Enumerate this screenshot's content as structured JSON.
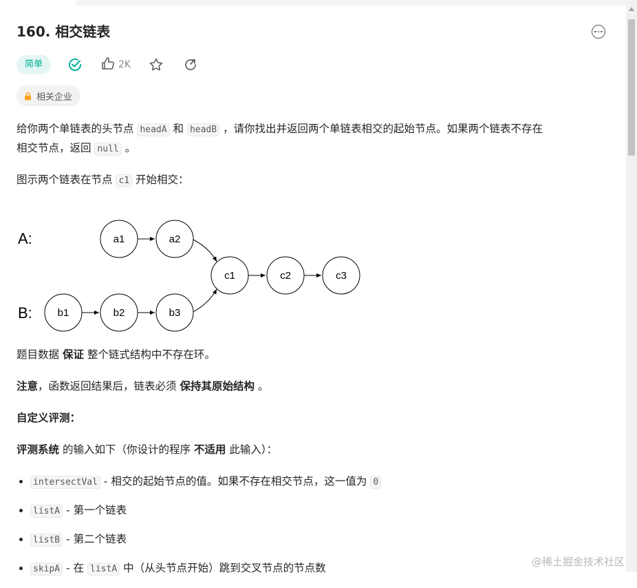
{
  "problem": {
    "title": "160. 相交链表",
    "difficulty": "简单",
    "likes": "2K",
    "company_tag": "相关企业"
  },
  "description": {
    "p1": {
      "t1": "给你两个单链表的头节点 ",
      "c1": "headA",
      "t2": " 和 ",
      "c2": "headB",
      "t3": " ，请你找出并返回两个单链表相交的起始节点。如果两个链表不存在",
      "t4": "相交节点，返回 ",
      "c3": "null",
      "t5": " 。"
    },
    "p2": {
      "t1": "图示两个链表在节点 ",
      "c1": "c1",
      "t2": " 开始相交："
    }
  },
  "diagram": {
    "label_a": "A:",
    "label_b": "B:",
    "nodes": {
      "a1": "a1",
      "a2": "a2",
      "b1": "b1",
      "b2": "b2",
      "b3": "b3",
      "c1": "c1",
      "c2": "c2",
      "c3": "c3"
    }
  },
  "notes": {
    "n1": {
      "t1": "题目数据 ",
      "b1": "保证",
      "t2": " 整个链式结构中不存在环。"
    },
    "n2": {
      "b1": "注意",
      "t1": "，函数返回结果后，链表必须 ",
      "b2": "保持其原始结构",
      "t2": " 。"
    },
    "n3": {
      "b1": "自定义评测："
    },
    "n4": {
      "b1": "评测系统",
      "t1": " 的输入如下（你设计的程序 ",
      "b2": "不适用",
      "t2": " 此输入）："
    }
  },
  "inputs": [
    {
      "code": "intersectVal",
      "text": " - 相交的起始节点的值。如果不存在相交节点，这一值为 ",
      "code2": "0"
    },
    {
      "code": "listA",
      "text": " - 第一个链表"
    },
    {
      "code": "listB",
      "text": " - 第二个链表"
    },
    {
      "code": "skipA",
      "text": " - 在 ",
      "code2": "listA",
      "text2": " 中（从头节点开始）跳到交叉节点的节点数"
    }
  ],
  "watermark": "@稀土掘金技术社区",
  "colors": {
    "accent_green": "#00af9b",
    "badge_bg": "#e3f6f3",
    "lock": "#ffa116"
  },
  "icons": [
    "more-icon",
    "check-circle-icon",
    "thumbs-up-icon",
    "star-icon",
    "share-icon",
    "lock-icon"
  ]
}
